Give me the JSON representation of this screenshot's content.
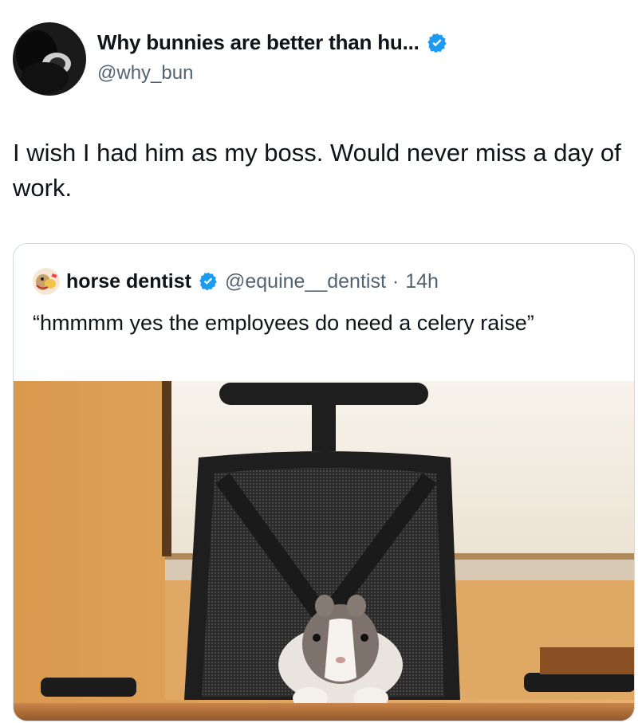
{
  "post": {
    "author_name": "Why bunnies are better than hu...",
    "author_handle": "@why_bun",
    "verified": true,
    "text": "I wish I had him as my boss. Would never miss a day of work."
  },
  "quoted_post": {
    "author_name": "horse dentist",
    "author_handle": "@equine__dentist",
    "separator": "·",
    "time": "14h",
    "verified": true,
    "text": "“hmmmm yes the employees do need a celery raise”"
  },
  "colors": {
    "verified_blue": "#1d9bf0",
    "secondary_text": "#536471",
    "border": "#cfd9de"
  },
  "icons": {
    "verified": "verified-badge-icon",
    "author_avatar": "black-bunny-avatar",
    "quote_avatar": "cartoon-horse-avatar"
  }
}
